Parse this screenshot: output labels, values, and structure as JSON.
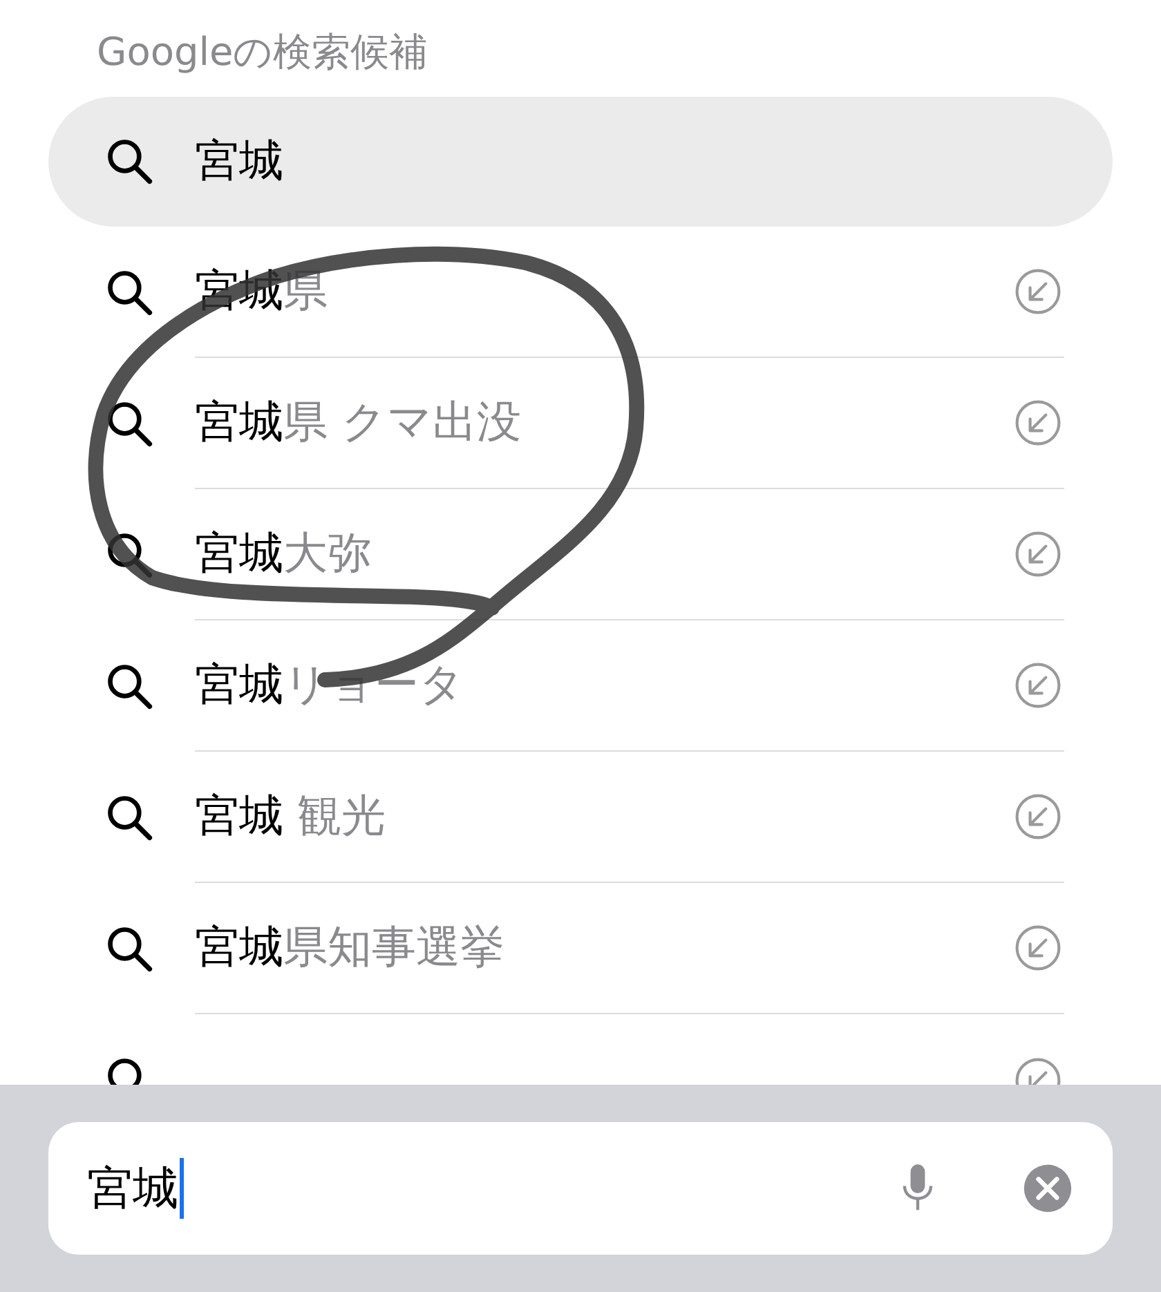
{
  "header": "Googleの検索候補",
  "top_suggestion": {
    "text": "宮城",
    "selected": true
  },
  "suggestions": [
    {
      "typed": "宮城",
      "completion": "県"
    },
    {
      "typed": "宮城",
      "completion": "県 クマ出没"
    },
    {
      "typed": "宮城",
      "completion": "大弥"
    },
    {
      "typed": "宮城",
      "completion": "リョータ"
    },
    {
      "typed": "宮城",
      "completion": " 観光"
    },
    {
      "typed": "宮城",
      "completion": "県知事選挙"
    }
  ],
  "search_field": {
    "value": "宮城"
  }
}
